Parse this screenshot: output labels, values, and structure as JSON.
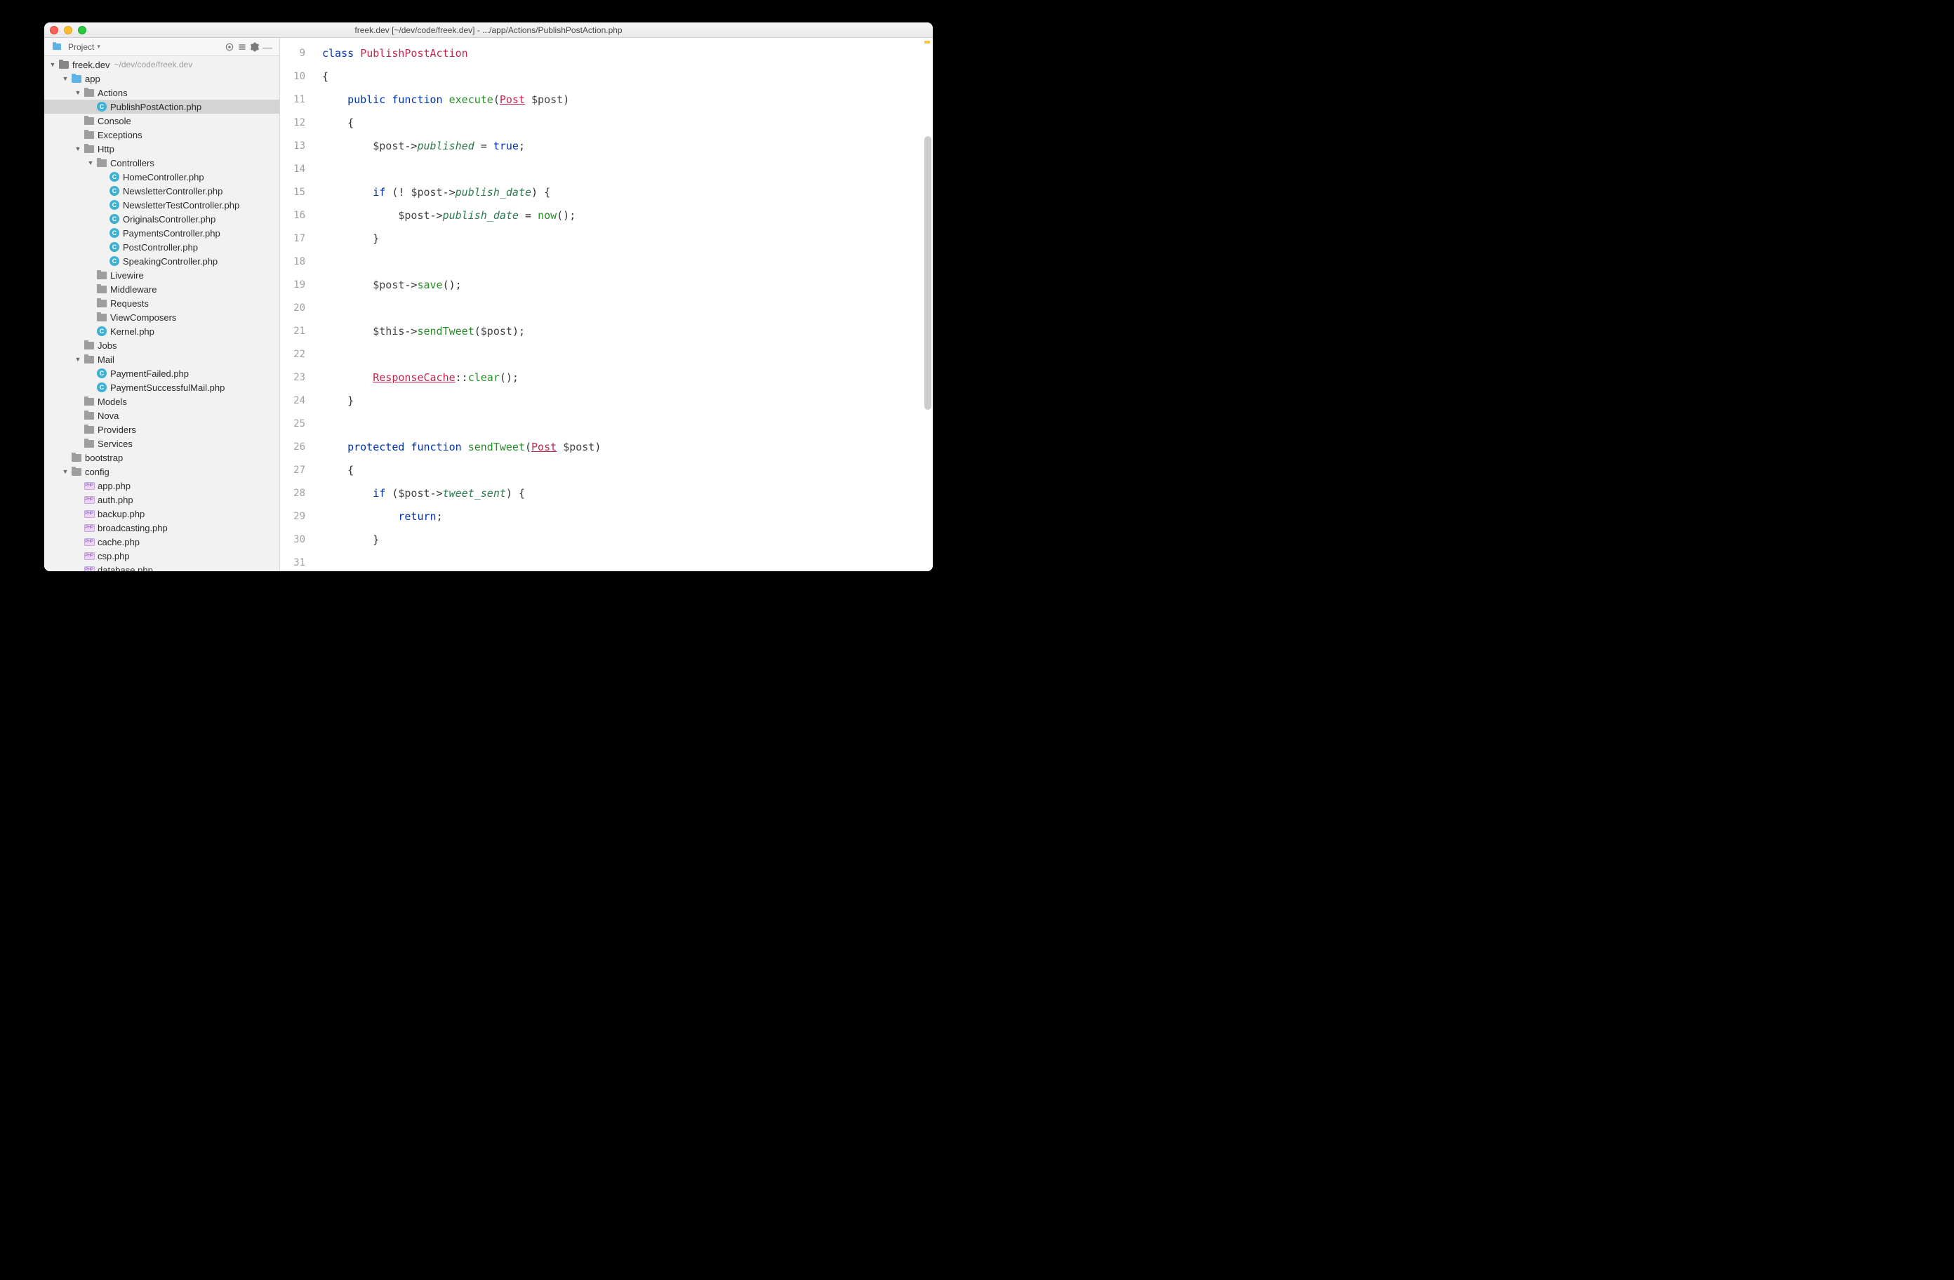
{
  "window": {
    "title": "freek.dev [~/dev/code/freek.dev] - .../app/Actions/PublishPostAction.php"
  },
  "sidebar": {
    "header_label": "Project",
    "root_label": "freek.dev",
    "root_path": "~/dev/code/freek.dev",
    "tree": [
      {
        "label": "app",
        "icon": "folder-blue",
        "expanded": true,
        "children": [
          {
            "label": "Actions",
            "icon": "folder-gray",
            "expanded": true,
            "children": [
              {
                "label": "PublishPostAction.php",
                "icon": "circle-c",
                "selected": true
              }
            ]
          },
          {
            "label": "Console",
            "icon": "folder-gray",
            "expanded": false
          },
          {
            "label": "Exceptions",
            "icon": "folder-gray",
            "expanded": false
          },
          {
            "label": "Http",
            "icon": "folder-gray",
            "expanded": true,
            "children": [
              {
                "label": "Controllers",
                "icon": "folder-gray",
                "expanded": true,
                "children": [
                  {
                    "label": "HomeController.php",
                    "icon": "circle-c"
                  },
                  {
                    "label": "NewsletterController.php",
                    "icon": "circle-c"
                  },
                  {
                    "label": "NewsletterTestController.php",
                    "icon": "circle-c"
                  },
                  {
                    "label": "OriginalsController.php",
                    "icon": "circle-c"
                  },
                  {
                    "label": "PaymentsController.php",
                    "icon": "circle-c"
                  },
                  {
                    "label": "PostController.php",
                    "icon": "circle-c"
                  },
                  {
                    "label": "SpeakingController.php",
                    "icon": "circle-c"
                  }
                ]
              },
              {
                "label": "Livewire",
                "icon": "folder-gray",
                "expanded": false
              },
              {
                "label": "Middleware",
                "icon": "folder-gray",
                "expanded": false
              },
              {
                "label": "Requests",
                "icon": "folder-gray",
                "expanded": false
              },
              {
                "label": "ViewComposers",
                "icon": "folder-gray",
                "expanded": false
              },
              {
                "label": "Kernel.php",
                "icon": "circle-c"
              }
            ]
          },
          {
            "label": "Jobs",
            "icon": "folder-gray",
            "expanded": false
          },
          {
            "label": "Mail",
            "icon": "folder-gray",
            "expanded": true,
            "children": [
              {
                "label": "PaymentFailed.php",
                "icon": "circle-c"
              },
              {
                "label": "PaymentSuccessfulMail.php",
                "icon": "circle-c"
              }
            ]
          },
          {
            "label": "Models",
            "icon": "folder-gray",
            "expanded": false
          },
          {
            "label": "Nova",
            "icon": "folder-gray",
            "expanded": false
          },
          {
            "label": "Providers",
            "icon": "folder-gray",
            "expanded": false
          },
          {
            "label": "Services",
            "icon": "folder-gray",
            "expanded": false
          }
        ]
      },
      {
        "label": "bootstrap",
        "icon": "folder-gray",
        "expanded": false
      },
      {
        "label": "config",
        "icon": "folder-gray",
        "expanded": true,
        "children": [
          {
            "label": "app.php",
            "icon": "php"
          },
          {
            "label": "auth.php",
            "icon": "php"
          },
          {
            "label": "backup.php",
            "icon": "php"
          },
          {
            "label": "broadcasting.php",
            "icon": "php"
          },
          {
            "label": "cache.php",
            "icon": "php"
          },
          {
            "label": "csp.php",
            "icon": "php"
          },
          {
            "label": "database.php",
            "icon": "php"
          }
        ]
      }
    ]
  },
  "editor": {
    "first_line": 9,
    "lines": [
      {
        "tokens": [
          [
            "kw",
            "class "
          ],
          [
            "cls",
            "PublishPostAction"
          ]
        ]
      },
      {
        "tokens": [
          [
            "punc",
            "{"
          ]
        ]
      },
      {
        "tokens": [
          [
            "punc",
            "    "
          ],
          [
            "kw",
            "public function "
          ],
          [
            "fn",
            "execute"
          ],
          [
            "punc",
            "("
          ],
          [
            "cls-u",
            "Post"
          ],
          [
            "punc",
            " "
          ],
          [
            "var",
            "$post"
          ],
          [
            "punc",
            ")"
          ]
        ]
      },
      {
        "tokens": [
          [
            "punc",
            "    {"
          ]
        ]
      },
      {
        "tokens": [
          [
            "punc",
            "        "
          ],
          [
            "var",
            "$post"
          ],
          [
            "punc",
            "->"
          ],
          [
            "prop",
            "published"
          ],
          [
            "punc",
            " = "
          ],
          [
            "bool",
            "true"
          ],
          [
            "punc",
            ";"
          ]
        ]
      },
      {
        "tokens": []
      },
      {
        "tokens": [
          [
            "punc",
            "        "
          ],
          [
            "kw",
            "if "
          ],
          [
            "punc",
            "(! "
          ],
          [
            "var",
            "$post"
          ],
          [
            "punc",
            "->"
          ],
          [
            "prop",
            "publish_date"
          ],
          [
            "punc",
            ") {"
          ]
        ]
      },
      {
        "tokens": [
          [
            "punc",
            "            "
          ],
          [
            "var",
            "$post"
          ],
          [
            "punc",
            "->"
          ],
          [
            "prop",
            "publish_date"
          ],
          [
            "punc",
            " = "
          ],
          [
            "fn",
            "now"
          ],
          [
            "punc",
            "();"
          ]
        ]
      },
      {
        "tokens": [
          [
            "punc",
            "        }"
          ]
        ]
      },
      {
        "tokens": []
      },
      {
        "tokens": [
          [
            "punc",
            "        "
          ],
          [
            "var",
            "$post"
          ],
          [
            "punc",
            "->"
          ],
          [
            "fn",
            "save"
          ],
          [
            "punc",
            "();"
          ]
        ]
      },
      {
        "tokens": []
      },
      {
        "tokens": [
          [
            "punc",
            "        "
          ],
          [
            "var",
            "$this"
          ],
          [
            "punc",
            "->"
          ],
          [
            "fn",
            "sendTweet"
          ],
          [
            "punc",
            "("
          ],
          [
            "var",
            "$post"
          ],
          [
            "punc",
            ");"
          ]
        ]
      },
      {
        "tokens": []
      },
      {
        "tokens": [
          [
            "punc",
            "        "
          ],
          [
            "cls-u",
            "ResponseCache"
          ],
          [
            "punc",
            "::"
          ],
          [
            "fn",
            "clear"
          ],
          [
            "punc",
            "();"
          ]
        ]
      },
      {
        "tokens": [
          [
            "punc",
            "    }"
          ]
        ]
      },
      {
        "tokens": []
      },
      {
        "tokens": [
          [
            "punc",
            "    "
          ],
          [
            "kw",
            "protected function "
          ],
          [
            "fn",
            "sendTweet"
          ],
          [
            "punc",
            "("
          ],
          [
            "cls-u",
            "Post"
          ],
          [
            "punc",
            " "
          ],
          [
            "var",
            "$post"
          ],
          [
            "punc",
            ")"
          ]
        ]
      },
      {
        "tokens": [
          [
            "punc",
            "    {"
          ]
        ]
      },
      {
        "tokens": [
          [
            "punc",
            "        "
          ],
          [
            "kw",
            "if "
          ],
          [
            "punc",
            "("
          ],
          [
            "var",
            "$post"
          ],
          [
            "punc",
            "->"
          ],
          [
            "prop",
            "tweet_sent"
          ],
          [
            "punc",
            ") {"
          ]
        ]
      },
      {
        "tokens": [
          [
            "punc",
            "            "
          ],
          [
            "kw",
            "return"
          ],
          [
            "punc",
            ";"
          ]
        ]
      },
      {
        "tokens": [
          [
            "punc",
            "        }"
          ]
        ]
      },
      {
        "tokens": []
      }
    ]
  }
}
